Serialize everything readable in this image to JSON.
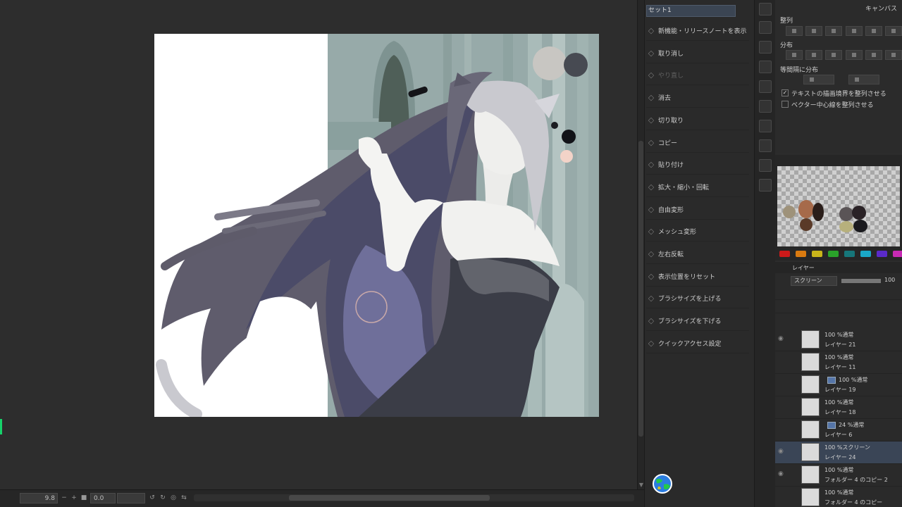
{
  "quick_access": {
    "set_name": "セット1",
    "items": [
      {
        "label": "新機能・リリースノートを表示",
        "icon": "info-icon"
      },
      {
        "label": "取り消し",
        "icon": "undo-icon"
      },
      {
        "label": "やり直し",
        "icon": "redo-icon"
      },
      {
        "label": "消去",
        "icon": "clear-icon"
      },
      {
        "label": "切り取り",
        "icon": "scissors-icon"
      },
      {
        "label": "コピー",
        "icon": "copy-icon"
      },
      {
        "label": "貼り付け",
        "icon": "paste-icon"
      },
      {
        "label": "拡大・縮小・回転",
        "icon": "scale-icon"
      },
      {
        "label": "自由変形",
        "icon": "free-transform-icon"
      },
      {
        "label": "メッシュ変形",
        "icon": "mesh-icon"
      },
      {
        "label": "左右反転",
        "icon": "flip-icon"
      },
      {
        "label": "表示位置をリセット",
        "icon": "reset-view-icon"
      },
      {
        "label": "ブラシサイズを上げる",
        "icon": "brush-up-icon"
      },
      {
        "label": "ブラシサイズを下げる",
        "icon": "brush-down-icon"
      },
      {
        "label": "クイックアクセス設定",
        "icon": "settings-icon"
      }
    ]
  },
  "align_panel": {
    "tab": "キャンバス",
    "align_label": "整列",
    "distribute_label": "分布",
    "equal_label": "等間隔に分布",
    "check_text_label": "テキストの描画境界を整列させる",
    "check_vector_label": "ベクター中心線を整列させる",
    "check_text": true,
    "check_vector": false
  },
  "palette_colors": [
    "#cc1a1a",
    "#d97a10",
    "#c8b41a",
    "#2aa22a",
    "#16767a",
    "#1aa8c8",
    "#5a2ac8",
    "#c82ab4"
  ],
  "layer_panel": {
    "tab": "レイヤー",
    "blend_mode": "スクリーン",
    "opacity": "100",
    "layers": [
      {
        "mode": "100 %通常",
        "name": "レイヤー 21",
        "visible": true,
        "selected": false,
        "clip": false
      },
      {
        "mode": "100 %通常",
        "name": "レイヤー 11",
        "visible": false,
        "selected": false,
        "clip": false
      },
      {
        "mode": "100 %通常",
        "name": "レイヤー 19",
        "visible": false,
        "selected": false,
        "clip": true
      },
      {
        "mode": "100 %通常",
        "name": "レイヤー 18",
        "visible": false,
        "selected": false,
        "clip": false
      },
      {
        "mode": "24 %通常",
        "name": "レイヤー 6",
        "visible": false,
        "selected": false,
        "clip": true
      },
      {
        "mode": "100 %スクリーン",
        "name": "レイヤー 24",
        "visible": true,
        "selected": true,
        "clip": false
      },
      {
        "mode": "100 %通常",
        "name": "フォルダー 4 のコピー 2",
        "visible": true,
        "selected": false,
        "clip": false
      },
      {
        "mode": "100 %通常",
        "name": "フォルダー 4 のコピー",
        "visible": false,
        "selected": false,
        "clip": false
      }
    ]
  },
  "status_bar": {
    "zoom": "9.8",
    "rotation": "0.0"
  }
}
